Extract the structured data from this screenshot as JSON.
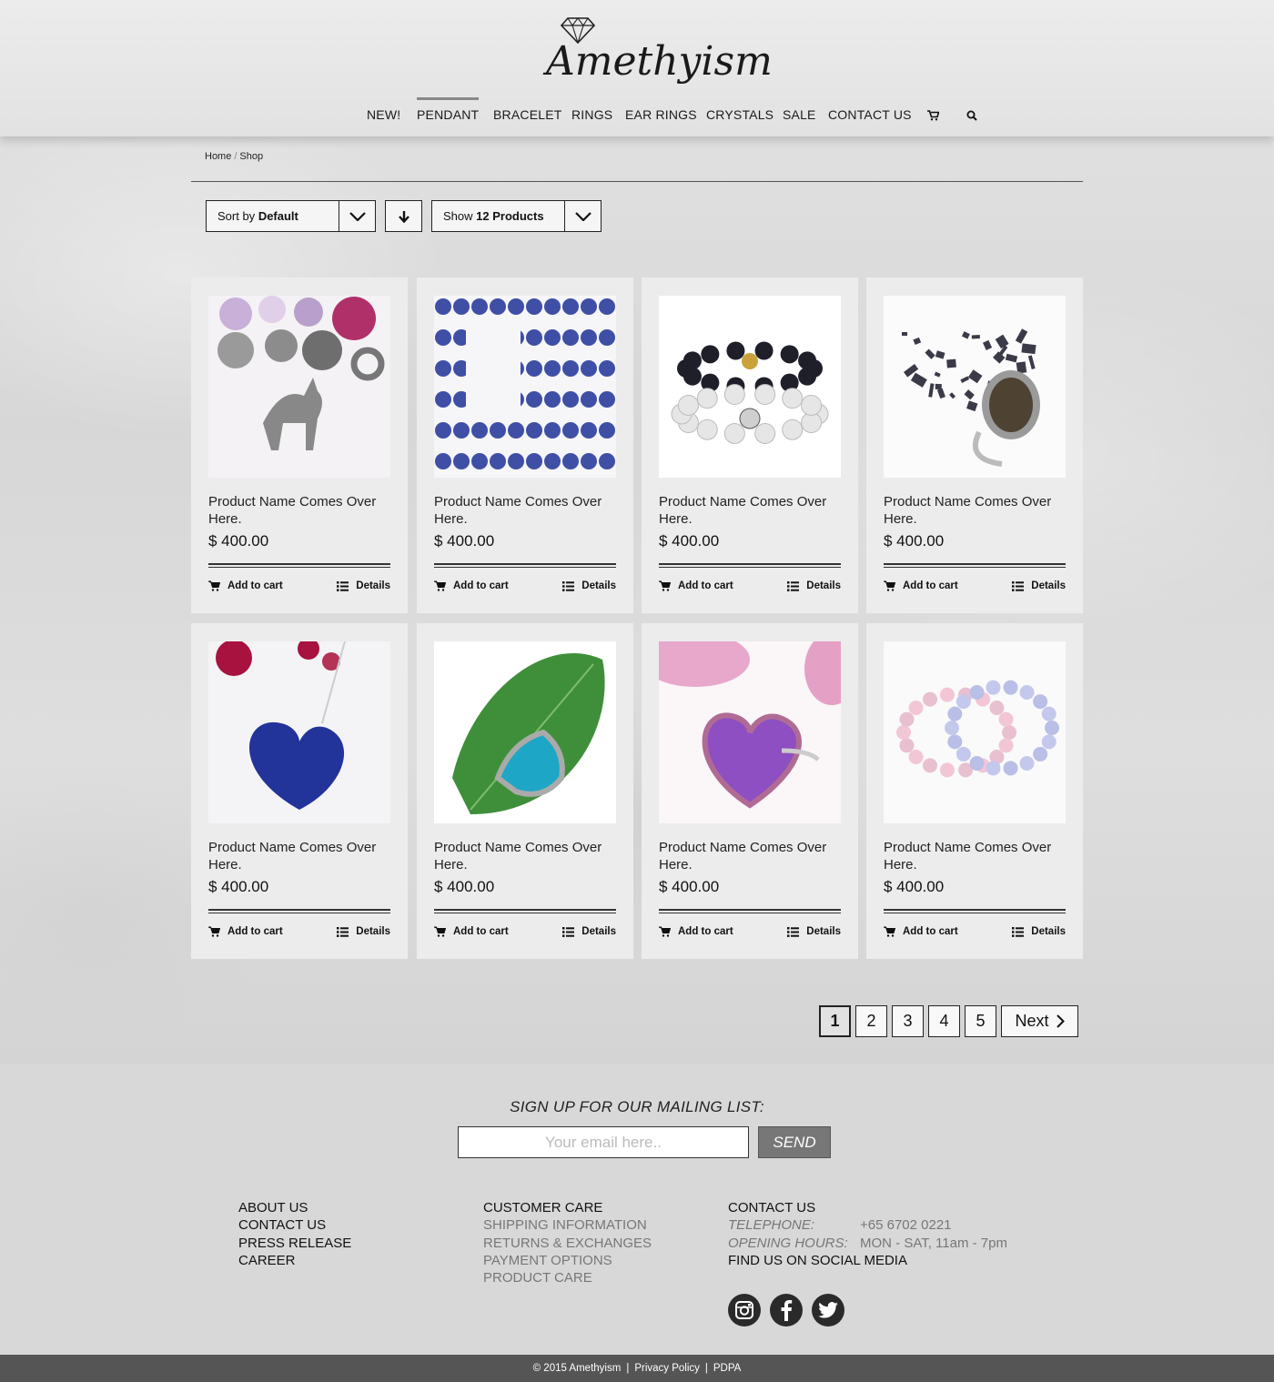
{
  "brand": {
    "logo_text": "Amethyism"
  },
  "nav": {
    "items": [
      "NEW!",
      "PENDANT",
      "BRACELET",
      "RINGS",
      "EAR RINGS",
      "CRYSTALS",
      "SALE",
      "CONTACT US"
    ],
    "active": "PENDANT",
    "cart_icon": "cart-icon",
    "search_icon": "search-icon"
  },
  "breadcrumb": {
    "home": "Home",
    "sep": "/",
    "current": "Shop"
  },
  "controls": {
    "sort_prefix": "Sort by",
    "sort_value": "Default",
    "show_prefix": "Show",
    "show_value": "12 Products"
  },
  "products": [
    {
      "name": "Product Name Comes Over Here.",
      "price": "$ 400.00",
      "cart_label": "Add to cart",
      "details_label": "Details",
      "image": "unicorn-charm-bracelet"
    },
    {
      "name": "Product Name Comes Over Here.",
      "price": "$ 400.00",
      "cart_label": "Add to cart",
      "details_label": "Details",
      "image": "blue-bead-strands"
    },
    {
      "name": "Product Name Comes Over Here.",
      "price": "$ 400.00",
      "cart_label": "Add to cart",
      "details_label": "Details",
      "image": "skull-bead-bracelets"
    },
    {
      "name": "Product Name Comes Over Here.",
      "price": "$ 400.00",
      "cart_label": "Add to cart",
      "details_label": "Details",
      "image": "smoky-quartz-ring"
    },
    {
      "name": "Product Name Comes Over Here.",
      "price": "$ 400.00",
      "cart_label": "Add to cart",
      "details_label": "Details",
      "image": "lapis-heart-pendant"
    },
    {
      "name": "Product Name Comes Over Here.",
      "price": "$ 400.00",
      "cart_label": "Add to cart",
      "details_label": "Details",
      "image": "turquoise-ring-leaf"
    },
    {
      "name": "Product Name Comes Over Here.",
      "price": "$ 400.00",
      "cart_label": "Add to cart",
      "details_label": "Details",
      "image": "amethyst-heart-ring"
    },
    {
      "name": "Product Name Comes Over Here.",
      "price": "$ 400.00",
      "cart_label": "Add to cart",
      "details_label": "Details",
      "image": "pastel-bead-bracelets"
    }
  ],
  "pagination": {
    "pages": [
      "1",
      "2",
      "3",
      "4",
      "5"
    ],
    "current": "1",
    "next_label": "Next"
  },
  "footer": {
    "signup_title": "SIGN UP FOR OUR MAILING LIST:",
    "email_placeholder": "Your email here..",
    "send_label": "SEND",
    "col1": [
      "ABOUT US",
      "CONTACT US",
      "PRESS RELEASE",
      "CAREER"
    ],
    "col2_head": "CUSTOMER CARE",
    "col2": [
      "SHIPPING INFORMATION",
      "RETURNS & EXCHANGES",
      "PAYMENT OPTIONS",
      "PRODUCT CARE"
    ],
    "col3_head": "CONTACT US",
    "telephone_label": "TELEPHONE:",
    "telephone": "+65 6702 0221",
    "hours_label": "OPENING HOURS:",
    "hours": "MON - SAT, 11am - 7pm",
    "social_head": "FIND US ON SOCIAL MEDIA",
    "social": [
      "instagram-icon",
      "facebook-icon",
      "twitter-icon"
    ]
  },
  "bottom": {
    "copyright": "© 2015 Amethyism",
    "privacy": "Privacy Policy",
    "pdpa": "PDPA",
    "sep": "|"
  }
}
